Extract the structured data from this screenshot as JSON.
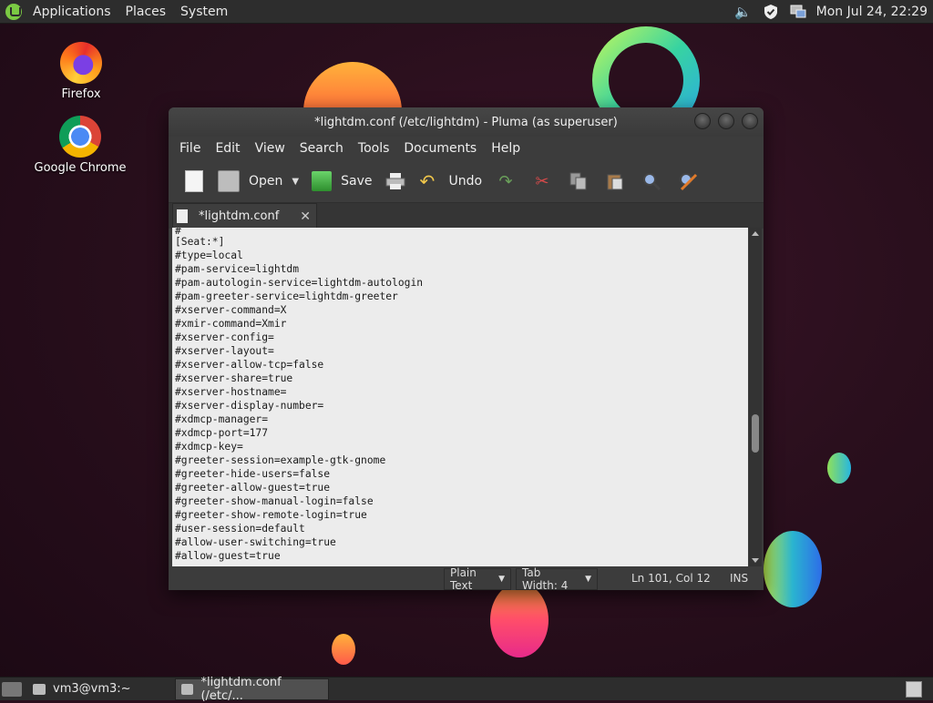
{
  "top_panel": {
    "menus": [
      "Applications",
      "Places",
      "System"
    ],
    "clock": "Mon Jul 24, 22:29",
    "tray_icons": [
      "volume-icon",
      "shield-icon",
      "network-icon"
    ]
  },
  "desktop": {
    "icons": [
      {
        "label": "Firefox",
        "icon": "firefox-icon"
      },
      {
        "label": "Google Chrome",
        "icon": "chrome-icon"
      }
    ]
  },
  "window": {
    "title": "*lightdm.conf (/etc/lightdm) - Pluma (as superuser)",
    "menu": [
      "File",
      "Edit",
      "View",
      "Search",
      "Tools",
      "Documents",
      "Help"
    ],
    "toolbar": {
      "open_label": "Open",
      "save_label": "Save",
      "undo_label": "Undo"
    },
    "tab": {
      "label": "*lightdm.conf"
    },
    "content_lines": [
      "#",
      "[Seat:*]",
      "#type=local",
      "#pam-service=lightdm",
      "#pam-autologin-service=lightdm-autologin",
      "#pam-greeter-service=lightdm-greeter",
      "#xserver-command=X",
      "#xmir-command=Xmir",
      "#xserver-config=",
      "#xserver-layout=",
      "#xserver-allow-tcp=false",
      "#xserver-share=true",
      "#xserver-hostname=",
      "#xserver-display-number=",
      "#xdmcp-manager=",
      "#xdmcp-port=177",
      "#xdmcp-key=",
      "#greeter-session=example-gtk-gnome",
      "#greeter-hide-users=false",
      "#greeter-allow-guest=true",
      "#greeter-show-manual-login=false",
      "#greeter-show-remote-login=true",
      "#user-session=default",
      "#allow-user-switching=true",
      "#allow-guest=true"
    ],
    "status": {
      "language": "Plain Text",
      "tab_width": "Tab Width:  4",
      "position": "Ln 101, Col 12",
      "mode": "INS"
    }
  },
  "taskbar": {
    "tasks": [
      {
        "label": "vm3@vm3:~",
        "active": false
      },
      {
        "label": "*lightdm.conf (/etc/...",
        "active": true
      }
    ]
  }
}
